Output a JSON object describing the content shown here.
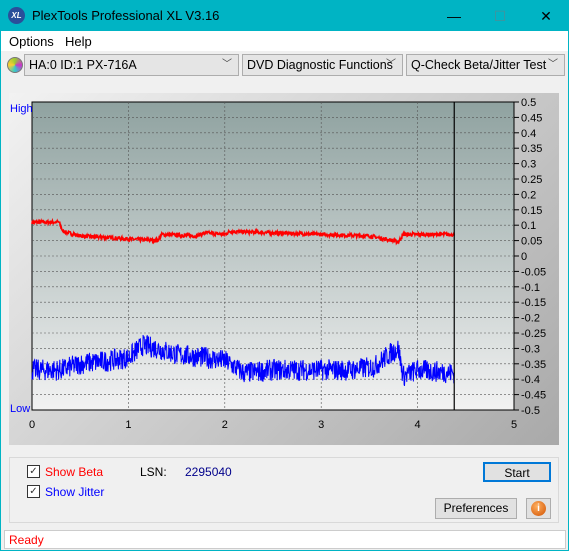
{
  "window": {
    "title": "PlexTools Professional XL V3.16",
    "logo_text": "XL",
    "minimize": "—",
    "maximize": "☐",
    "close": "✕"
  },
  "menu": [
    "Options",
    "Help"
  ],
  "toolbar": {
    "drive": "HA:0 ID:1  PX-716A",
    "function": "DVD Diagnostic Functions",
    "test": "Q-Check Beta/Jitter Test"
  },
  "chart_data": {
    "type": "line",
    "xlim": [
      0,
      5
    ],
    "ylim": [
      -0.5,
      0.5
    ],
    "x_ticks": [
      "0",
      "1",
      "2",
      "3",
      "4",
      "5"
    ],
    "y_ticks": [
      "0.5",
      "0.45",
      "0.4",
      "0.35",
      "0.3",
      "0.25",
      "0.2",
      "0.15",
      "0.1",
      "0.05",
      "0",
      "-0.05",
      "-0.1",
      "-0.15",
      "-0.2",
      "-0.25",
      "-0.3",
      "-0.35",
      "-0.4",
      "-0.45",
      "-0.5"
    ],
    "left_labels": {
      "high": "High",
      "low": "Low"
    },
    "marker_x": 4.38,
    "grid": true,
    "colors": {
      "beta": "#ff0000",
      "jitter": "#0000ff",
      "plot_bg_top": "#8fa2a0",
      "plot_bg_bottom": "#f2f2f2"
    },
    "series": [
      {
        "id": "beta",
        "x": [
          0,
          0.28,
          0.32,
          0.5,
          0.8,
          1.0,
          1.3,
          1.35,
          1.7,
          1.8,
          2.0,
          2.05,
          2.5,
          3.0,
          3.5,
          3.75,
          3.8,
          3.85,
          4.1,
          4.38
        ],
        "y": [
          0.11,
          0.11,
          0.08,
          0.065,
          0.06,
          0.055,
          0.05,
          0.07,
          0.065,
          0.075,
          0.07,
          0.08,
          0.075,
          0.07,
          0.065,
          0.05,
          0.045,
          0.07,
          0.07,
          0.07
        ]
      },
      {
        "id": "jitter",
        "x": [
          0,
          0.3,
          0.5,
          0.8,
          1.0,
          1.15,
          1.3,
          1.5,
          1.8,
          2.0,
          2.2,
          2.5,
          3.0,
          3.3,
          3.55,
          3.7,
          3.8,
          3.85,
          4.0,
          4.38
        ],
        "y": [
          -0.37,
          -0.37,
          -0.35,
          -0.34,
          -0.33,
          -0.29,
          -0.3,
          -0.32,
          -0.33,
          -0.34,
          -0.38,
          -0.37,
          -0.37,
          -0.37,
          -0.36,
          -0.32,
          -0.3,
          -0.39,
          -0.37,
          -0.38
        ]
      }
    ]
  },
  "options": {
    "show_beta": "Show Beta",
    "show_jitter": "Show Jitter",
    "beta_checked": true,
    "jitter_checked": true,
    "lsn_label": "LSN:",
    "lsn_value": "2295040"
  },
  "buttons": {
    "start": "Start",
    "preferences": "Preferences",
    "info": "i"
  },
  "status": "Ready"
}
